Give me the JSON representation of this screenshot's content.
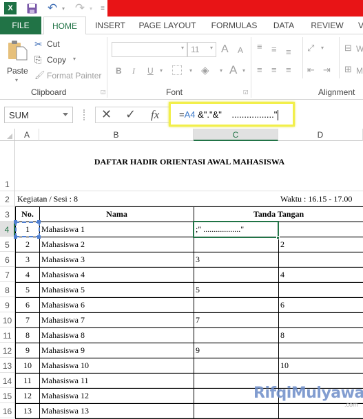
{
  "app": {
    "quick_access": [
      {
        "name": "excel-logo-icon",
        "glyph": "X"
      },
      {
        "name": "save-icon",
        "glyph": "💾"
      },
      {
        "name": "undo-icon",
        "glyph": "↶"
      },
      {
        "name": "redo-icon",
        "glyph": "↷"
      },
      {
        "name": "customize-qat-icon",
        "glyph": "="
      }
    ],
    "titlebar_color": "#e81416",
    "accent": "#217346"
  },
  "ribbon_tabs": [
    {
      "label": "FILE"
    },
    {
      "label": "HOME"
    },
    {
      "label": "INSERT"
    },
    {
      "label": "PAGE LAYOUT"
    },
    {
      "label": "FORMULAS"
    },
    {
      "label": "DATA"
    },
    {
      "label": "REVIEW"
    },
    {
      "label": "V"
    }
  ],
  "ribbon": {
    "clipboard": {
      "paste": "Paste",
      "cut": "Cut",
      "copy": "Copy",
      "format_painter": "Format Painter",
      "label": "Clipboard"
    },
    "font": {
      "font_name": "",
      "font_size": "11",
      "bold": "B",
      "italic": "I",
      "underline": "U",
      "font_color_glyph": "A",
      "grow_glyph": "A",
      "shrink_glyph": "A",
      "label": "Font"
    },
    "alignment": {
      "wrap_partial": "W",
      "merge_partial": "M",
      "label": "Alignment"
    }
  },
  "formula_bar": {
    "name_box": "SUM",
    "cancel_glyph": "✕",
    "enter_glyph": "✓",
    "fx_label": "fx",
    "formula_prefix": "=",
    "formula_ref": "A4",
    "formula_rest": " &\".\"&\"    .................\""
  },
  "columns": [
    {
      "label": "A"
    },
    {
      "label": "B"
    },
    {
      "label": "C"
    },
    {
      "label": "D"
    }
  ],
  "rows": [
    "1",
    "2",
    "3",
    "4",
    "5",
    "6",
    "7",
    "8",
    "9",
    "10",
    "11",
    "12",
    "13",
    "14",
    "15",
    "16"
  ],
  "sheet": {
    "title": "DAFTAR HADIR ORIENTASI AWAL MAHASISWA",
    "kegiatan": "Kegiatan / Sesi : 8",
    "waktu": "Waktu : 16.15 - 17.00",
    "headers": {
      "no": "No.",
      "nama": "Nama",
      "tanda_tangan": "Tanda Tangan"
    },
    "editing_cell_text": ";\"     ..................\"",
    "students": [
      {
        "no": "1",
        "nama": "Mahasiswa 1",
        "c": "",
        "d": ""
      },
      {
        "no": "2",
        "nama": "Mahasiswa 2",
        "c": "",
        "d": "2"
      },
      {
        "no": "3",
        "nama": "Mahasiswa 3",
        "c": "3",
        "d": ""
      },
      {
        "no": "4",
        "nama": "Mahasiswa 4",
        "c": "",
        "d": "4"
      },
      {
        "no": "5",
        "nama": "Mahasiswa 5",
        "c": "5",
        "d": ""
      },
      {
        "no": "6",
        "nama": "Mahasiswa 6",
        "c": "",
        "d": "6"
      },
      {
        "no": "7",
        "nama": "Mahasiswa 7",
        "c": "7",
        "d": ""
      },
      {
        "no": "8",
        "nama": "Mahasiswa 8",
        "c": "",
        "d": "8"
      },
      {
        "no": "9",
        "nama": "Mahasiswa 9",
        "c": "9",
        "d": ""
      },
      {
        "no": "10",
        "nama": "Mahasiswa 10",
        "c": "",
        "d": "10"
      },
      {
        "no": "11",
        "nama": "Mahasiswa 11",
        "c": "",
        "d": ""
      },
      {
        "no": "12",
        "nama": "Mahasiswa 12",
        "c": "",
        "d": ""
      },
      {
        "no": "13",
        "nama": "Mahasiswa 13",
        "c": "",
        "d": ""
      }
    ]
  },
  "watermark": {
    "main": "RifqiMulyawan",
    "sub": ".com"
  }
}
